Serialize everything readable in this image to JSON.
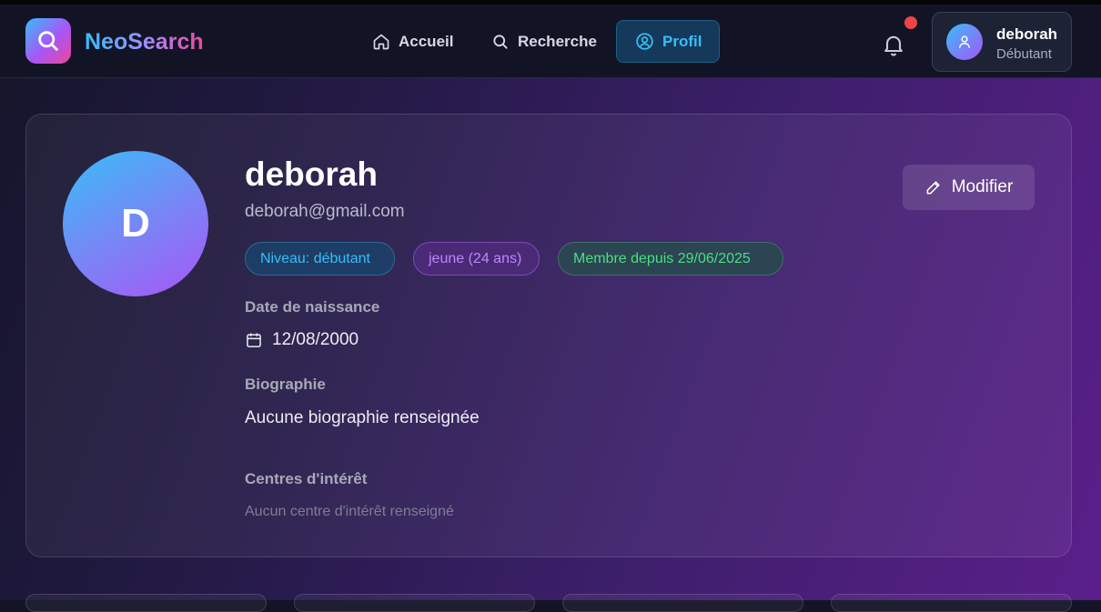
{
  "app": {
    "name": "NeoSearch"
  },
  "nav": [
    {
      "label": "Accueil",
      "icon": "home-icon",
      "active": false
    },
    {
      "label": "Recherche",
      "icon": "search-icon",
      "active": false
    },
    {
      "label": "Profil",
      "icon": "user-circle-icon",
      "active": true
    }
  ],
  "user_chip": {
    "name": "deborah",
    "level": "Débutant"
  },
  "profile": {
    "avatar_letter": "D",
    "name": "deborah",
    "email": "deborah@gmail.com",
    "edit_label": "Modifier",
    "badges": {
      "level": "Niveau: débutant",
      "age": "jeune (24 ans)",
      "member": "Membre depuis 29/06/2025"
    },
    "birth_label": "Date de naissance",
    "birth_value": "12/08/2000",
    "bio_label": "Biographie",
    "bio_value": "Aucune biographie renseignée",
    "interests_label": "Centres d'intérêt",
    "interests_value": "Aucun centre d'intérêt renseigné"
  },
  "colors": {
    "accent_cyan": "#38bdf8",
    "accent_purple": "#a855f7",
    "accent_pink": "#ec4899",
    "notification": "#ef4444",
    "member_green": "#4ade80"
  }
}
